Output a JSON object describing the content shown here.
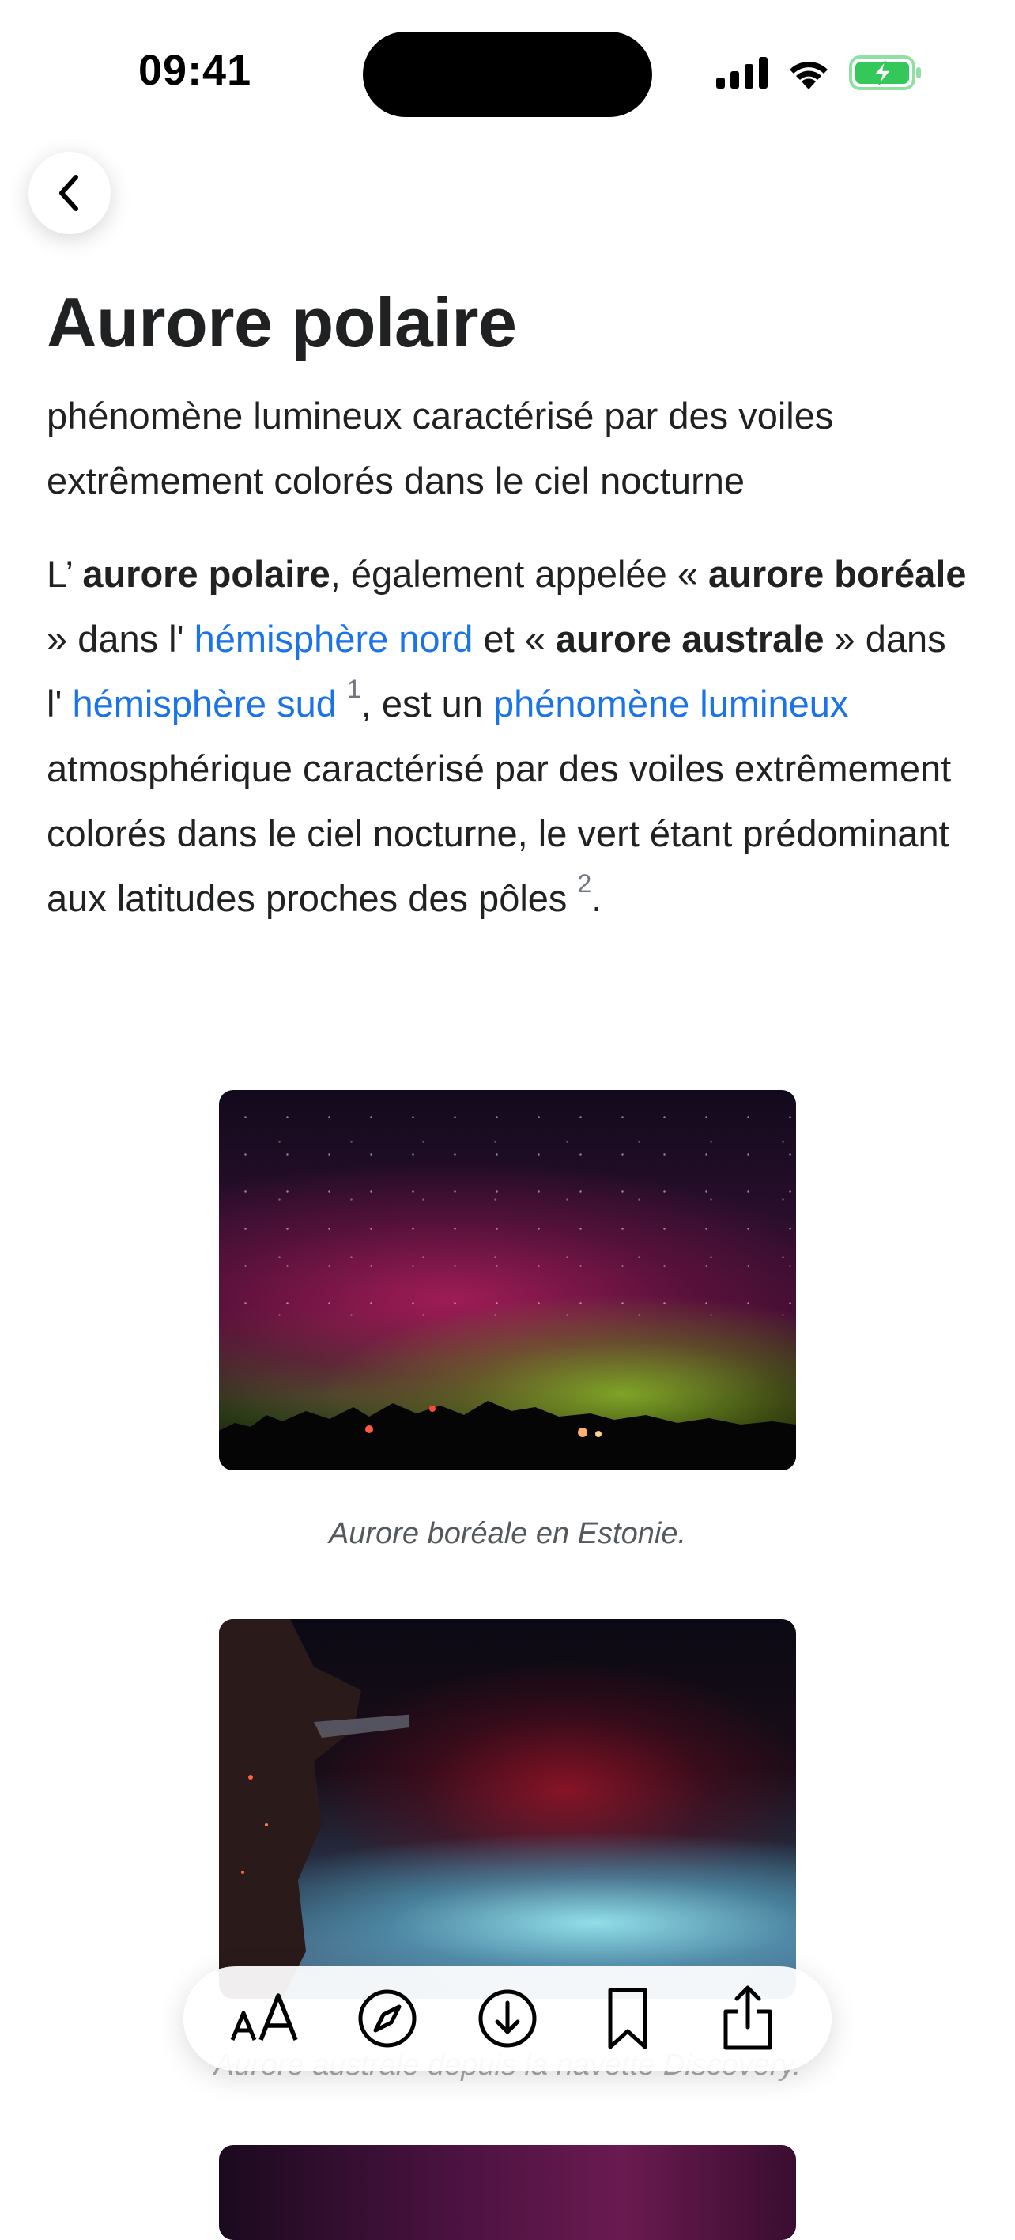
{
  "status_bar": {
    "time": "09:41"
  },
  "navigation": {
    "back_icon": "chevron-left-icon"
  },
  "article": {
    "title": "Aurore polaire",
    "description": "phénomène lumineux caractérisé par des voiles extrêmement colorés dans le ciel nocturne",
    "paragraph": {
      "t1": "L’ ",
      "b1": "aurore polaire",
      "t2": ", également appelée « ",
      "b2": "aurore boréale",
      "t3": " » dans l' ",
      "link1": "hémisphère nord",
      "t4": " et « ",
      "b3": "aurore australe",
      "t5": " » dans l' ",
      "link2": "hémisphère sud",
      "ref1": "1",
      "t6": ", est un ",
      "link3": "phénomène lumineux",
      "t7": " atmosphérique caractérisé par des voiles extrêmement colorés dans le ciel nocturne, le vert étant prédominant aux latitudes proches des pôles ",
      "ref2": "2",
      "t8": "."
    },
    "figures": [
      {
        "caption": "Aurore boréale en Estonie."
      },
      {
        "caption": "Aurore australe depuis la navette Discovery."
      }
    ]
  },
  "toolbar": {
    "items": [
      {
        "name": "text-size",
        "icon": "text-size-icon"
      },
      {
        "name": "explore",
        "icon": "compass-icon"
      },
      {
        "name": "download",
        "icon": "download-icon"
      },
      {
        "name": "bookmark",
        "icon": "bookmark-icon"
      },
      {
        "name": "share",
        "icon": "share-icon"
      }
    ]
  },
  "colors": {
    "link": "#1a73e8",
    "text": "#202122",
    "caption": "#54595d",
    "battery": "#34c759"
  }
}
